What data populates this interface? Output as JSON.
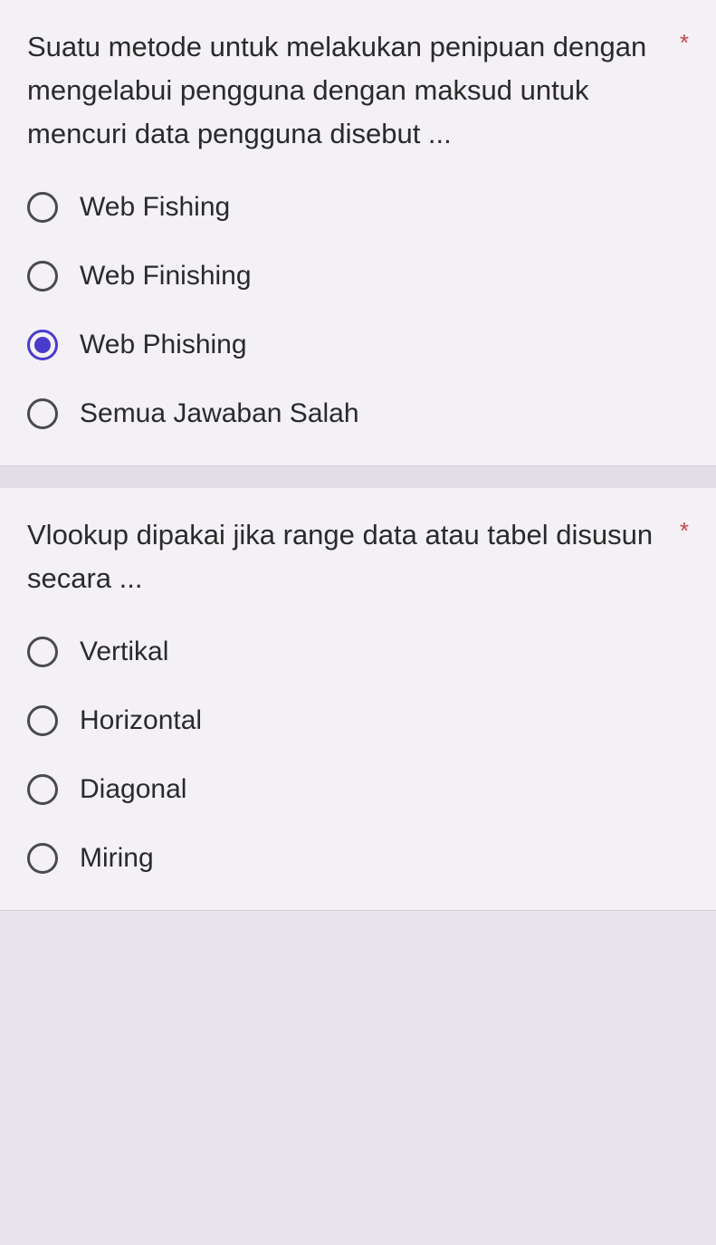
{
  "questions": [
    {
      "text": "Suatu metode untuk melakukan penipuan dengan mengelabui pengguna dengan maksud untuk mencuri data pengguna disebut ...",
      "required": "*",
      "options": [
        {
          "label": "Web Fishing",
          "selected": false
        },
        {
          "label": "Web Finishing",
          "selected": false
        },
        {
          "label": "Web Phishing",
          "selected": true
        },
        {
          "label": "Semua Jawaban Salah",
          "selected": false
        }
      ]
    },
    {
      "text": "Vlookup dipakai jika range data atau tabel disusun secara ...",
      "required": "*",
      "options": [
        {
          "label": "Vertikal",
          "selected": false
        },
        {
          "label": "Horizontal",
          "selected": false
        },
        {
          "label": "Diagonal",
          "selected": false
        },
        {
          "label": "Miring",
          "selected": false
        }
      ]
    }
  ]
}
